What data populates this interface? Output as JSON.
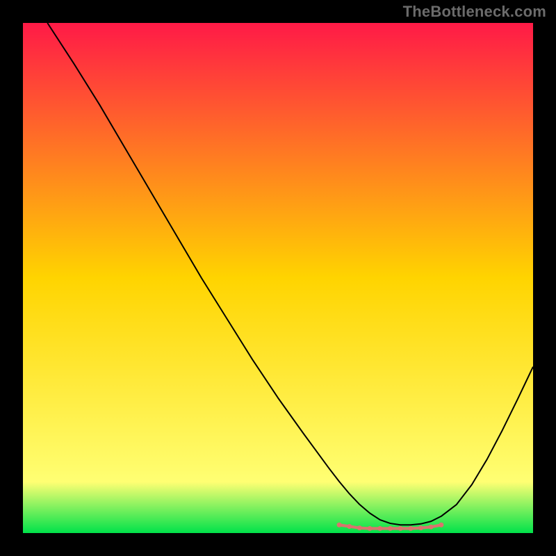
{
  "watermark": "TheBottleneck.com",
  "chart_data": {
    "type": "line",
    "title": "",
    "xlabel": "",
    "ylabel": "",
    "xlim": [
      0,
      100
    ],
    "ylim": [
      0,
      100
    ],
    "gradient": {
      "stops": [
        {
          "offset": 0,
          "color": "#ff1a47"
        },
        {
          "offset": 50,
          "color": "#ffd400"
        },
        {
          "offset": 90,
          "color": "#ffff73"
        },
        {
          "offset": 100,
          "color": "#00e24a"
        }
      ]
    },
    "series": [
      {
        "name": "bottleneck-curve",
        "color": "#000000",
        "width": 2,
        "x": [
          4.8,
          10,
          15,
          20,
          25,
          30,
          35,
          40,
          45,
          50,
          55,
          60,
          62,
          64,
          66,
          68,
          70,
          72,
          74,
          76,
          78,
          80,
          82,
          85,
          88,
          91,
          94,
          97,
          100
        ],
        "y": [
          100,
          92,
          84,
          75.5,
          67,
          58.5,
          50,
          42,
          34,
          26.5,
          19.5,
          12.7,
          10.1,
          7.7,
          5.6,
          3.9,
          2.6,
          1.9,
          1.6,
          1.6,
          1.8,
          2.3,
          3.3,
          5.6,
          9.5,
          14.5,
          20.2,
          26.3,
          32.6
        ]
      },
      {
        "name": "optimal-zone-highlight",
        "color": "#d9746d",
        "width": 7,
        "x": [
          62,
          64,
          66,
          68,
          70,
          72,
          74,
          76,
          78,
          80,
          82
        ],
        "y": [
          1.6,
          1.3,
          1.0,
          0.9,
          0.9,
          0.9,
          0.9,
          0.9,
          1.0,
          1.2,
          1.6
        ]
      }
    ]
  }
}
